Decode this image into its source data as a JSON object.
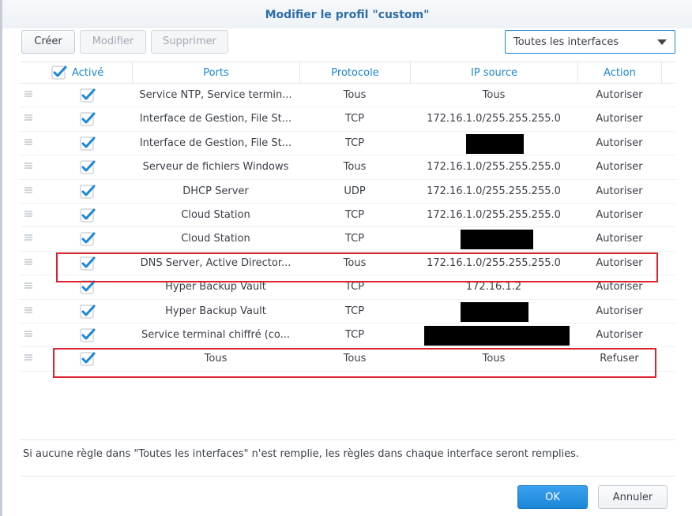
{
  "dialog": {
    "title": "Modifier le profil \"custom\""
  },
  "toolbar": {
    "create_label": "Créer",
    "modify_label": "Modifier",
    "delete_label": "Supprimer",
    "interface_select": "Toutes les interfaces"
  },
  "table": {
    "headers": {
      "enabled": "Activé",
      "ports": "Ports",
      "protocol": "Protocole",
      "source_ip": "IP source",
      "action": "Action"
    },
    "rows": [
      {
        "ports": "Service NTP, Service termin...",
        "protocol": "Tous",
        "source_ip": "Tous",
        "action": "Autoriser",
        "enabled": true,
        "redacted": false
      },
      {
        "ports": "Interface de Gestion, File St...",
        "protocol": "TCP",
        "source_ip": "172.16.1.0/255.255.255.0",
        "action": "Autoriser",
        "enabled": true,
        "redacted": false
      },
      {
        "ports": "Interface de Gestion, File St...",
        "protocol": "TCP",
        "source_ip": "",
        "action": "Autoriser",
        "enabled": true,
        "redacted": true
      },
      {
        "ports": "Serveur de fichiers Windows",
        "protocol": "Tous",
        "source_ip": "172.16.1.0/255.255.255.0",
        "action": "Autoriser",
        "enabled": true,
        "redacted": false
      },
      {
        "ports": "DHCP Server",
        "protocol": "UDP",
        "source_ip": "172.16.1.0/255.255.255.0",
        "action": "Autoriser",
        "enabled": true,
        "redacted": false
      },
      {
        "ports": "Cloud Station",
        "protocol": "TCP",
        "source_ip": "172.16.1.0/255.255.255.0",
        "action": "Autoriser",
        "enabled": true,
        "redacted": false
      },
      {
        "ports": "Cloud Station",
        "protocol": "TCP",
        "source_ip": "",
        "action": "Autoriser",
        "enabled": true,
        "redacted": true
      },
      {
        "ports": "DNS Server, Active Director...",
        "protocol": "Tous",
        "source_ip": "172.16.1.0/255.255.255.0",
        "action": "Autoriser",
        "enabled": true,
        "redacted": false
      },
      {
        "ports": "Hyper Backup Vault",
        "protocol": "TCP",
        "source_ip": "172.16.1.2",
        "action": "Autoriser",
        "enabled": true,
        "redacted": false
      },
      {
        "ports": "Hyper Backup Vault",
        "protocol": "TCP",
        "source_ip": "",
        "action": "Autoriser",
        "enabled": true,
        "redacted": true
      },
      {
        "ports": "Service terminal chiffré (co...",
        "protocol": "TCP",
        "source_ip": "",
        "action": "Autoriser",
        "enabled": true,
        "redacted": true
      },
      {
        "ports": "Tous",
        "protocol": "Tous",
        "source_ip": "Tous",
        "action": "Refuser",
        "enabled": true,
        "redacted": false
      }
    ]
  },
  "note": "Si aucune règle dans \"Toutes les interfaces\" n'est remplie, les règles dans chaque interface seront remplies.",
  "footer": {
    "ok_label": "OK",
    "cancel_label": "Annuler"
  },
  "colors": {
    "accent": "#1b87d6",
    "highlight": "#d9232e",
    "redaction": "#000000"
  }
}
